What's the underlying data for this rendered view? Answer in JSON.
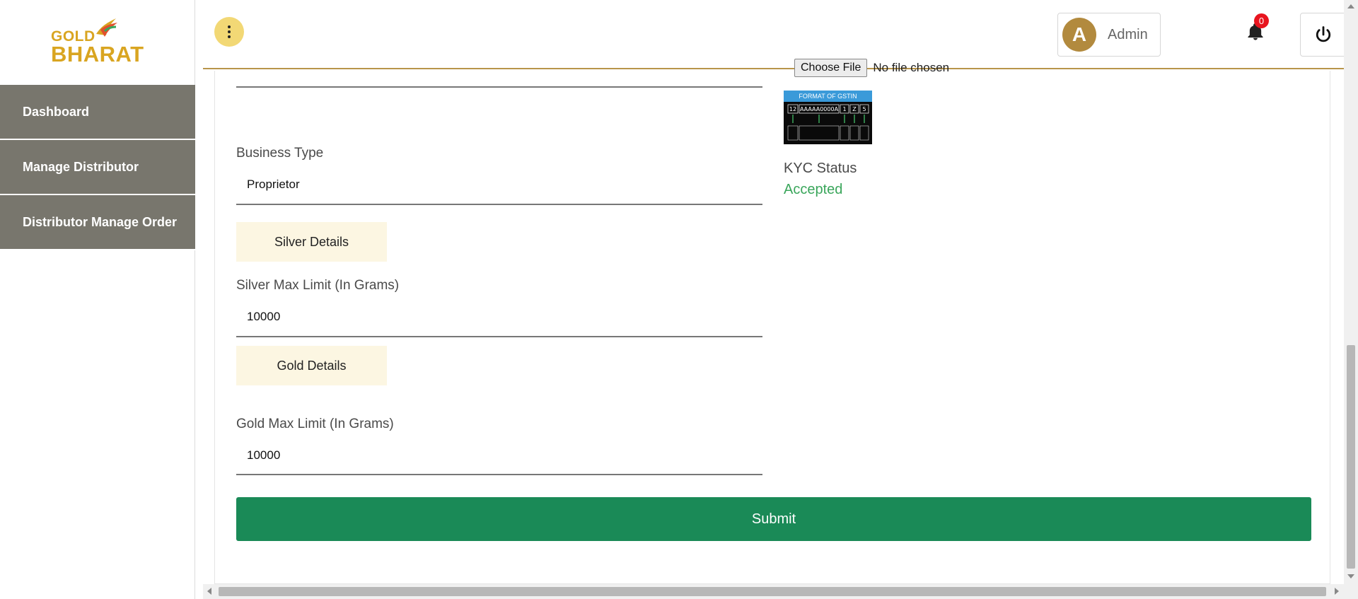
{
  "brand": {
    "logo_line1": "GOLD",
    "logo_line2": "BHARAT",
    "color": "#d9a521"
  },
  "sidebar": {
    "items": [
      {
        "label": "Dashboard"
      },
      {
        "label": "Manage Distributor"
      },
      {
        "label": "Distributor Manage Order"
      }
    ],
    "item_bg": "#78766d"
  },
  "header": {
    "menu_icon": "more-vertical-icon",
    "user": {
      "avatar_letter": "A",
      "name": "Admin"
    },
    "notifications": {
      "icon": "bell-icon",
      "count": "0"
    },
    "power_icon": "power-icon",
    "accent_border": "#b8954a"
  },
  "form": {
    "file_input": {
      "button_label": "Choose File",
      "status": "No file chosen"
    },
    "gstin_image": {
      "title": "FORMAT OF GSTIN",
      "segments": [
        "12",
        "AAAAA0000A",
        "1",
        "Z",
        "5"
      ]
    },
    "kyc": {
      "label": "KYC Status",
      "value": "Accepted",
      "color": "#3aa65b"
    },
    "business_type": {
      "label": "Business Type",
      "value": "Proprietor"
    },
    "silver_section": {
      "label": "Silver Details"
    },
    "silver_max": {
      "label": "Silver Max Limit (In Grams)",
      "value": "10000"
    },
    "gold_section": {
      "label": "Gold Details"
    },
    "gold_max": {
      "label": "Gold Max Limit (In Grams)",
      "value": "10000"
    },
    "submit": {
      "label": "Submit",
      "color": "#1a8a57"
    }
  }
}
